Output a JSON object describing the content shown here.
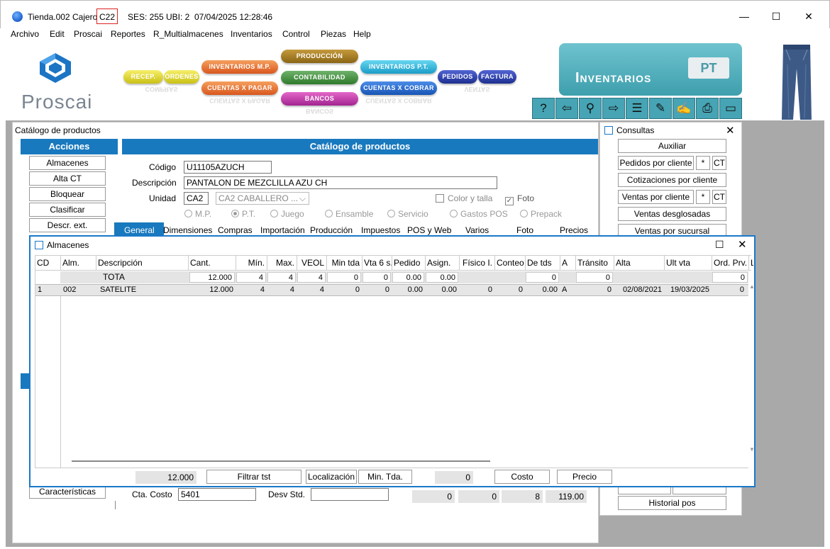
{
  "window": {
    "title_parts": [
      "Tienda.002",
      "Cajero",
      "C22",
      "SES: 255",
      "UBI: 2",
      "07/04/2025 12:28:46"
    ],
    "minimize": "—",
    "maximize": "☐",
    "close": "✕"
  },
  "menu": [
    "Archivo",
    "Edit",
    "Proscai",
    "Reportes",
    "R_Multialmacenes",
    "Inventarios",
    "Control",
    "Piezas",
    "Help"
  ],
  "ribbon": {
    "brand": "Proscai",
    "modules": {
      "recep": "RECEP.",
      "ordenes": "ORDENES",
      "inv_mp": "INVENTARIOS M.P.",
      "cuentas_pagar": "CUENTAS X PAGAR",
      "produccion": "PRODUCCIÓN",
      "contabilidad": "CONTABILIDAD",
      "bancos": "BANCOS",
      "inv_pt": "INVENTARIOS P.T.",
      "cuentas_cobrar": "CUENTAS X COBRAR",
      "pedidos": "PEDIDOS",
      "factura": "FACTURA"
    },
    "reflections": {
      "compras": "COMPRAS",
      "cuentas_pagar": "CUENTAS X PAGAR",
      "bancos": "BANCOS",
      "cuentas_cobrar": "CUENTAS X COBRAR",
      "ventas": "VENTAS"
    },
    "banner_title": "Inventarios",
    "banner_tag": "PT",
    "tool_glyphs": [
      "?",
      "⇦",
      "⚲",
      "⇨",
      "☰",
      "✎",
      "✍",
      "⎙",
      "▭"
    ]
  },
  "catalogo": {
    "window_title": "Catálogo de productos",
    "acciones_header": "Acciones",
    "acciones": [
      "Almacenes",
      "Alta CT",
      "Bloquear",
      "Clasificar",
      "Descr. ext."
    ],
    "caracteristicas": "Características",
    "header": "Catálogo de productos",
    "codigo_label": "Código",
    "codigo": "U11105AZUCH",
    "descripcion_label": "Descripción",
    "descripcion": "PANTALON DE MEZCLILLA AZU CH",
    "unidad_label": "Unidad",
    "unidad": "CA2",
    "unidad_desc": "CA2 CABALLERO ...",
    "color_talla": "Color y talla",
    "foto": "Foto",
    "radios": [
      "M.P.",
      "P.T.",
      "Juego",
      "Ensamble",
      "Servicio",
      "Gastos POS",
      "Prepack"
    ],
    "tabs": [
      "General",
      "Dimensiones",
      "Compras",
      "Importación",
      "Producción",
      "Impuestos",
      "POS y Web",
      "Varios",
      "Foto",
      "Precios"
    ],
    "cta_costo_label": "Cta. Costo",
    "cta_costo": "5401",
    "desv_std_label": "Desv Std.",
    "desv_std": "",
    "bottom_values": [
      "0",
      "0",
      "8",
      "119.00"
    ]
  },
  "consultas": {
    "title": "Consultas",
    "auxiliar": "Auxiliar",
    "pedidos_cliente": "Pedidos por cliente",
    "cotizaciones": "Cotizaciones por cliente",
    "ventas_cliente": "Ventas por cliente",
    "star": "*",
    "ct": "CT",
    "ventas_desglosadas": "Ventas desglosadas",
    "ventas_sucursal": "Ventas por sucursal",
    "historial": "Historial pos"
  },
  "almacenes": {
    "title": "Almacenes",
    "columns": [
      "CD",
      "Alm.",
      "Descripción",
      "Cant.",
      "Mín.",
      "Max.",
      "VEOL",
      "Min tda",
      "Vta 6 s.",
      "Pedido",
      "Asign.",
      "Físico I.",
      "Conteo",
      "De tds",
      "A",
      "Tránsito",
      "Alta",
      "Ult vta",
      "Ord. Prv.",
      "L"
    ],
    "total_row": {
      "label": "TOTA",
      "cant": "12.000",
      "min": "4",
      "max": "4",
      "veol": "4",
      "min_tda": "0",
      "vta6": "0",
      "pedido": "0.00",
      "asign": "0.00",
      "de_tds": "0",
      "transito": "0",
      "ord_prv": "0"
    },
    "rows": [
      {
        "cd": "1",
        "alm": "002",
        "desc": "SATELITE",
        "cant": "12.000",
        "min": "4",
        "max": "4",
        "veol": "4",
        "min_tda": "0",
        "vta6": "0",
        "pedido": "0.00",
        "asign": "0.00",
        "fisico": "0",
        "conteo": "0",
        "de_tds": "0.00",
        "a": "A",
        "transito": "0",
        "alta": "02/08/2021",
        "ult_vta": "19/03/2025",
        "ord_prv": "0"
      }
    ],
    "footer": {
      "total": "12.000",
      "filtrar": "Filtrar tst",
      "localizacion": "Localización",
      "min_tda": "Min. Tda.",
      "zero": "0",
      "costo": "Costo",
      "precio": "Precio"
    }
  }
}
